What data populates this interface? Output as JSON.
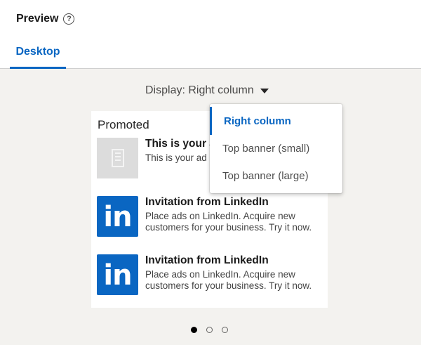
{
  "header": {
    "title": "Preview",
    "help_icon": "question-circle-icon"
  },
  "tabs": [
    {
      "label": "Desktop",
      "active": true
    }
  ],
  "display_select": {
    "label": "Display: Right column",
    "icon": "caret-down-icon"
  },
  "dropdown": {
    "options": [
      {
        "label": "Right column",
        "selected": true
      },
      {
        "label": "Top banner (small)",
        "selected": false
      },
      {
        "label": "Top banner (large)",
        "selected": false
      }
    ]
  },
  "ad_card": {
    "label": "Promoted",
    "items": [
      {
        "headline": "This is your a",
        "body": "This is your ad",
        "logo": "building-placeholder-icon"
      },
      {
        "headline": "Invitation from LinkedIn",
        "body": "Place ads on LinkedIn. Acquire new customers for your business. Try it now.",
        "logo": "linkedin-logo-icon"
      },
      {
        "headline": "Invitation from LinkedIn",
        "body": "Place ads on LinkedIn. Acquire new customers for your business. Try it now.",
        "logo": "linkedin-logo-icon"
      }
    ],
    "logo_text": "in"
  },
  "pagination": {
    "count": 3,
    "active_index": 0
  },
  "colors": {
    "accent": "#0a66c2",
    "stage_background": "#f3f2ef"
  }
}
